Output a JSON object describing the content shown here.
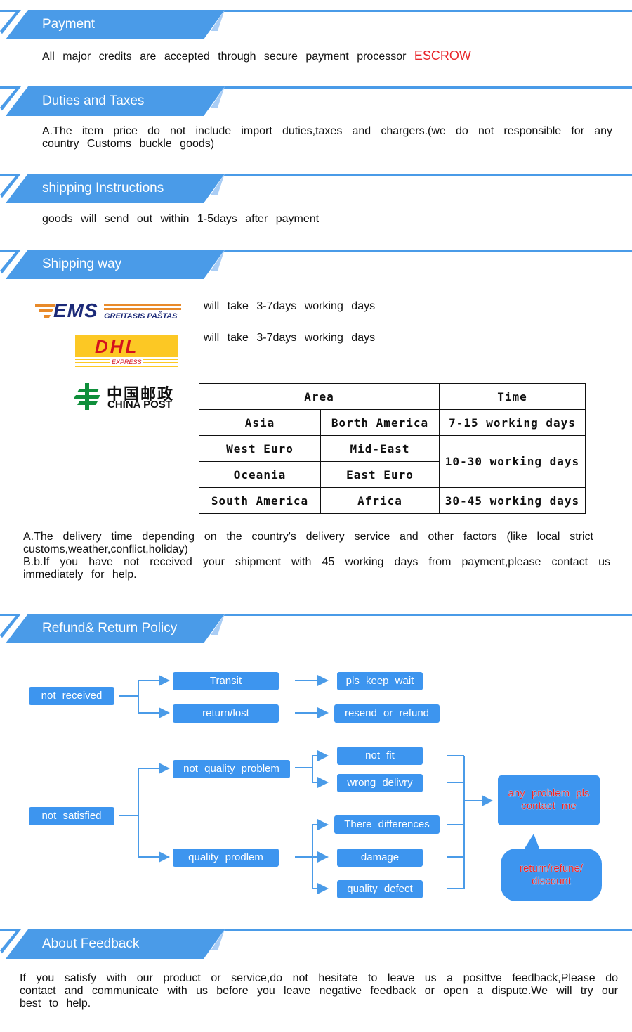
{
  "sections": {
    "payment": {
      "title": "Payment",
      "text": "All major credits are accepted through secure payment processor",
      "highlight": "ESCROW"
    },
    "duties": {
      "title": "Duties and Taxes",
      "text": "A.The item price do not include import duties,taxes and chargers.(we do not responsible for any country Customs buckle goods)"
    },
    "shipping_instructions": {
      "title": "shipping Instructions",
      "text": "goods will send out within 1-5days after payment"
    },
    "shipping_way": {
      "title": "Shipping way",
      "carriers": [
        {
          "name": "EMS",
          "subtitle": "GREITASIS PAŠTAS",
          "note": "will take 3-7days working days"
        },
        {
          "name": "DHL",
          "subtitle": "EXPRESS",
          "note": "will take 3-7days working days"
        },
        {
          "name": "中国邮政",
          "subtitle": "CHINA POST"
        }
      ],
      "table": {
        "headers": {
          "area": "Area",
          "time": "Time"
        },
        "rows": [
          {
            "a": "Asia",
            "b": "Borth America",
            "time": "7-15 working days"
          },
          {
            "a": "West Euro",
            "b": "Mid-East",
            "time": "10-30 working days"
          },
          {
            "a": "Oceania",
            "b": "East Euro"
          },
          {
            "a": "South America",
            "b": "Africa",
            "time": "30-45 working days"
          }
        ]
      },
      "note_a": "A.The delivery time depending on the country's delivery service and other factors (like local strict customs,weather,conflict,holiday)",
      "note_b": "B.b.If you have not received your shipment with 45 working days from payment,please contact us immediately for help."
    },
    "refund": {
      "title": "Refund& Return Policy",
      "flow": {
        "not_received": "not received",
        "transit": "Transit",
        "return_lost": "return/lost",
        "keep_wait": "pls keep wait",
        "resend_refund": "resend or refund",
        "not_satisfied": "not satisfied",
        "not_quality": "not quality problem",
        "quality": "quality prodlem",
        "not_fit": "not fit",
        "wrong_delivery": "wrong delivry",
        "differences": "There differences",
        "damage": "damage",
        "quality_defect": "quality defect",
        "contact_line1": "any problem pls",
        "contact_line2": "contact me",
        "outcome_line1": "return/refune/",
        "outcome_line2": "discount"
      }
    },
    "feedback": {
      "title": "About Feedback",
      "text": "If you satisfy with our product or service,do not hesitate to leave us a posittve feedback,Please do contact and communicate with us before you leave negative feedback or open a dispute.We will try our best to help."
    }
  },
  "colors": {
    "accent": "#4a9be8",
    "node": "#3d95ef",
    "highlight": "#e8252a"
  }
}
